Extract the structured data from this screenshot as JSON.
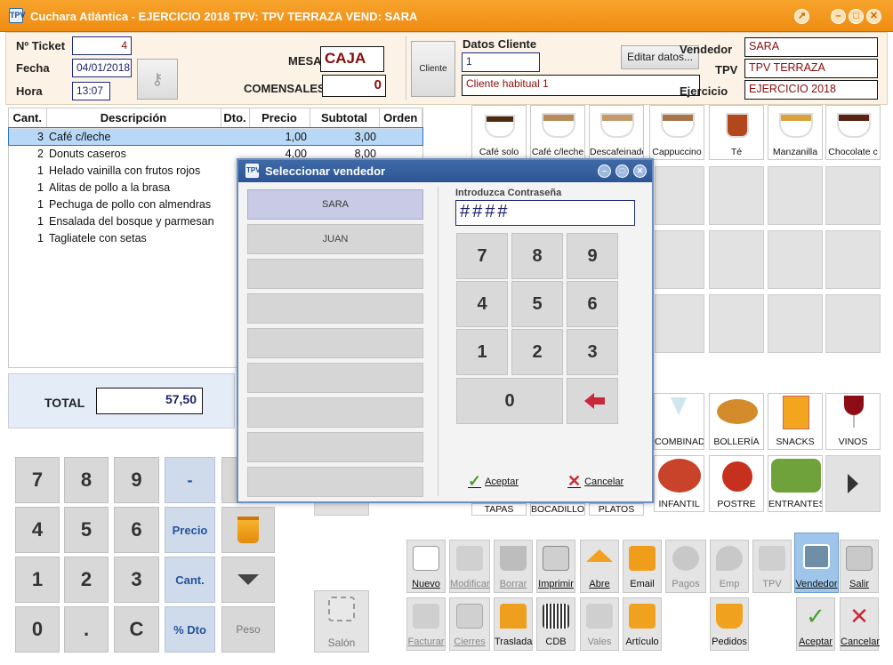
{
  "window": {
    "title": "Cuchara Atlántica - EJERCICIO 2018 TPV: TPV TERRAZA VEND: SARA",
    "app_icon": "TPV"
  },
  "header": {
    "ticket_label": "Nº Ticket",
    "ticket_value": "4",
    "fecha_label": "Fecha",
    "fecha_value": "04/01/2018",
    "hora_label": "Hora",
    "hora_value": "13:07",
    "mesa_label": "MESA",
    "mesa_value": "CAJA",
    "comensales_label": "COMENSALES",
    "comensales_value": "0",
    "cliente_button": "Cliente",
    "datos_cliente_label": "Datos Cliente",
    "cliente_code": "1",
    "cliente_name": "Cliente habitual 1",
    "editar_button": "Editar datos...",
    "vendedor_label": "Vendedor",
    "vendedor_value": "SARA",
    "tpv_label": "TPV",
    "tpv_value": "TPV TERRAZA",
    "ejercicio_label": "Ejercicio",
    "ejercicio_value": "EJERCICIO 2018"
  },
  "ticket": {
    "columns": [
      "Cant.",
      "Descripción",
      "Dto.",
      "Precio",
      "Subtotal",
      "Orden"
    ],
    "rows": [
      {
        "qty": "3",
        "desc": "Café c/leche",
        "dto": "",
        "precio": "1,00",
        "subtotal": "3,00",
        "selected": true
      },
      {
        "qty": "2",
        "desc": "Donuts caseros",
        "dto": "",
        "precio": "4,00",
        "subtotal": "8,00"
      },
      {
        "qty": "1",
        "desc": "Helado vainilla con frutos rojos",
        "dto": "",
        "precio": "",
        "subtotal": ""
      },
      {
        "qty": "1",
        "desc": "Alitas de pollo a la brasa",
        "dto": "",
        "precio": "",
        "subtotal": ""
      },
      {
        "qty": "1",
        "desc": "Pechuga de pollo con almendras",
        "dto": "",
        "precio": "",
        "subtotal": ""
      },
      {
        "qty": "1",
        "desc": "Ensalada del bosque y parmesan",
        "dto": "",
        "precio": "",
        "subtotal": ""
      },
      {
        "qty": "1",
        "desc": "Tagliatele con setas",
        "dto": "",
        "precio": "",
        "subtotal": ""
      }
    ]
  },
  "total": {
    "label": "TOTAL",
    "value": "57,50"
  },
  "keypad": {
    "keys": [
      "7",
      "8",
      "9",
      "-",
      "4",
      "5",
      "6",
      "Precio",
      "1",
      "2",
      "3",
      "Cant.",
      "0",
      ".",
      "C",
      "% Dto"
    ],
    "peso": "Peso"
  },
  "products_top": [
    "Café solo",
    "Café c/leche",
    "Descafeinado",
    "Cappuccino",
    "Té",
    "Manzanilla",
    "Chocolate c"
  ],
  "families": [
    "COMBINADOS",
    "BOLLERÍA",
    "SNACKS",
    "VINOS"
  ],
  "families2": [
    "TAPAS",
    "BOCADILLOS",
    "PLATOS",
    "INFANTIL",
    "POSTRE",
    "ENTRANTES"
  ],
  "salon": "Salón",
  "toolbar1": [
    "Nuevo",
    "Modificar",
    "Borrar",
    "Imprimir",
    "Abre",
    "Email",
    "Pagos",
    "Emp",
    "TPV",
    "Vendedor",
    "Salir"
  ],
  "toolbar2": [
    "Facturar",
    "Cierres",
    "Traslada",
    "CDB",
    "Vales",
    "Artículo",
    "Pedidos",
    "Aceptar",
    "Cancelar"
  ],
  "dialog": {
    "title": "Seleccionar vendedor",
    "vendors": [
      "SARA",
      "JUAN"
    ],
    "password_label": "Introduzca Contraseña",
    "password_value": "####",
    "keys": [
      "7",
      "8",
      "9",
      "4",
      "5",
      "6",
      "1",
      "2",
      "3",
      "0"
    ],
    "accept": "Aceptar",
    "cancel": "Cancelar"
  },
  "colors": {
    "title_orange": "#ef8c12",
    "dialog_blue": "#2d5595",
    "header_bg": "#fcf3e6"
  }
}
